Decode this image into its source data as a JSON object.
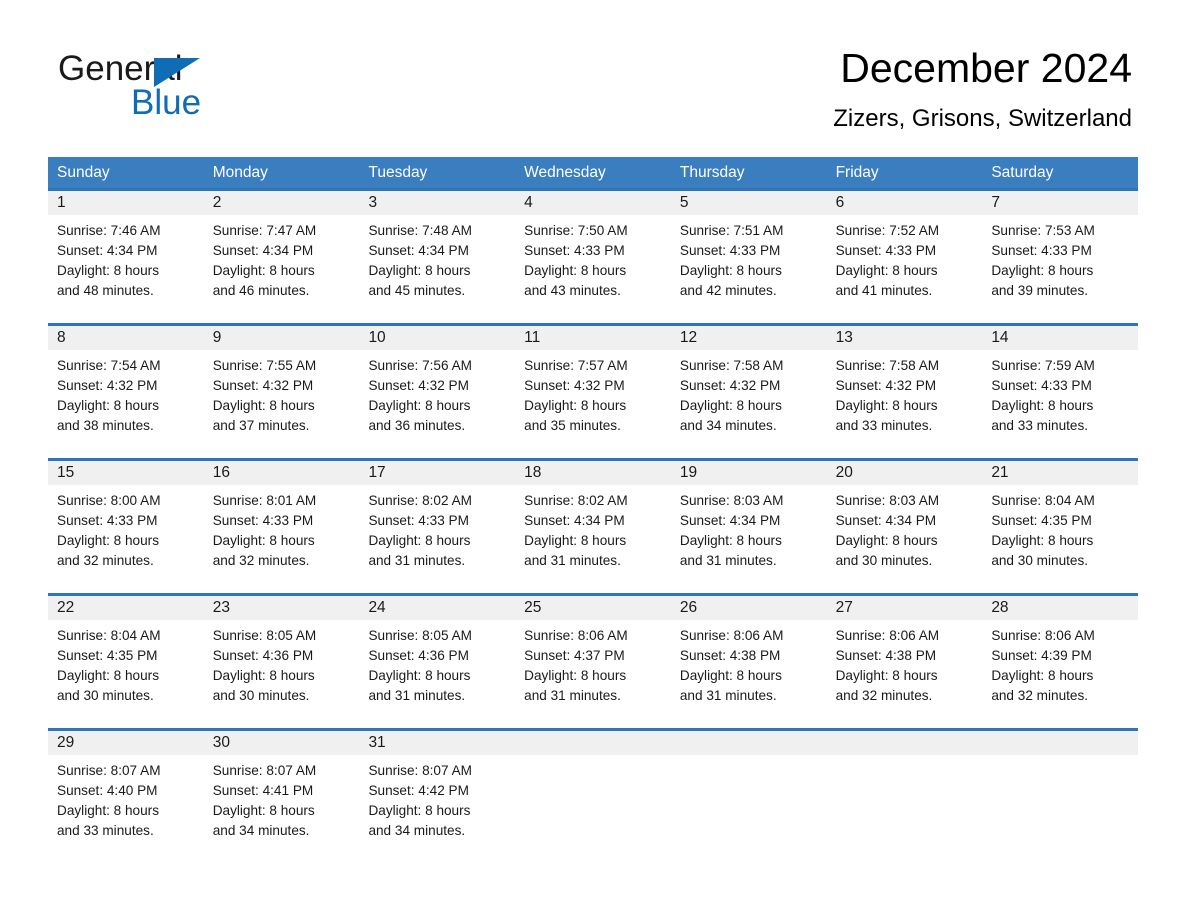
{
  "brand": {
    "name_part1": "General",
    "name_part2": "Blue",
    "triangle_color": "#0f6cb5"
  },
  "header": {
    "title": "December 2024",
    "subtitle": "Zizers, Grisons, Switzerland"
  },
  "theme": {
    "header_blue": "#3a7ebf",
    "rule_blue": "#2f76b8",
    "daynum_band": "#f0f0f0",
    "text": "#1a1a1a",
    "page_background": "#ffffff"
  },
  "calendar": {
    "day_headers": [
      "Sunday",
      "Monday",
      "Tuesday",
      "Wednesday",
      "Thursday",
      "Friday",
      "Saturday"
    ],
    "weeks": [
      [
        {
          "day": "1",
          "sunrise": "Sunrise: 7:46 AM",
          "sunset": "Sunset: 4:34 PM",
          "daylight1": "Daylight: 8 hours",
          "daylight2": "and 48 minutes."
        },
        {
          "day": "2",
          "sunrise": "Sunrise: 7:47 AM",
          "sunset": "Sunset: 4:34 PM",
          "daylight1": "Daylight: 8 hours",
          "daylight2": "and 46 minutes."
        },
        {
          "day": "3",
          "sunrise": "Sunrise: 7:48 AM",
          "sunset": "Sunset: 4:34 PM",
          "daylight1": "Daylight: 8 hours",
          "daylight2": "and 45 minutes."
        },
        {
          "day": "4",
          "sunrise": "Sunrise: 7:50 AM",
          "sunset": "Sunset: 4:33 PM",
          "daylight1": "Daylight: 8 hours",
          "daylight2": "and 43 minutes."
        },
        {
          "day": "5",
          "sunrise": "Sunrise: 7:51 AM",
          "sunset": "Sunset: 4:33 PM",
          "daylight1": "Daylight: 8 hours",
          "daylight2": "and 42 minutes."
        },
        {
          "day": "6",
          "sunrise": "Sunrise: 7:52 AM",
          "sunset": "Sunset: 4:33 PM",
          "daylight1": "Daylight: 8 hours",
          "daylight2": "and 41 minutes."
        },
        {
          "day": "7",
          "sunrise": "Sunrise: 7:53 AM",
          "sunset": "Sunset: 4:33 PM",
          "daylight1": "Daylight: 8 hours",
          "daylight2": "and 39 minutes."
        }
      ],
      [
        {
          "day": "8",
          "sunrise": "Sunrise: 7:54 AM",
          "sunset": "Sunset: 4:32 PM",
          "daylight1": "Daylight: 8 hours",
          "daylight2": "and 38 minutes."
        },
        {
          "day": "9",
          "sunrise": "Sunrise: 7:55 AM",
          "sunset": "Sunset: 4:32 PM",
          "daylight1": "Daylight: 8 hours",
          "daylight2": "and 37 minutes."
        },
        {
          "day": "10",
          "sunrise": "Sunrise: 7:56 AM",
          "sunset": "Sunset: 4:32 PM",
          "daylight1": "Daylight: 8 hours",
          "daylight2": "and 36 minutes."
        },
        {
          "day": "11",
          "sunrise": "Sunrise: 7:57 AM",
          "sunset": "Sunset: 4:32 PM",
          "daylight1": "Daylight: 8 hours",
          "daylight2": "and 35 minutes."
        },
        {
          "day": "12",
          "sunrise": "Sunrise: 7:58 AM",
          "sunset": "Sunset: 4:32 PM",
          "daylight1": "Daylight: 8 hours",
          "daylight2": "and 34 minutes."
        },
        {
          "day": "13",
          "sunrise": "Sunrise: 7:58 AM",
          "sunset": "Sunset: 4:32 PM",
          "daylight1": "Daylight: 8 hours",
          "daylight2": "and 33 minutes."
        },
        {
          "day": "14",
          "sunrise": "Sunrise: 7:59 AM",
          "sunset": "Sunset: 4:33 PM",
          "daylight1": "Daylight: 8 hours",
          "daylight2": "and 33 minutes."
        }
      ],
      [
        {
          "day": "15",
          "sunrise": "Sunrise: 8:00 AM",
          "sunset": "Sunset: 4:33 PM",
          "daylight1": "Daylight: 8 hours",
          "daylight2": "and 32 minutes."
        },
        {
          "day": "16",
          "sunrise": "Sunrise: 8:01 AM",
          "sunset": "Sunset: 4:33 PM",
          "daylight1": "Daylight: 8 hours",
          "daylight2": "and 32 minutes."
        },
        {
          "day": "17",
          "sunrise": "Sunrise: 8:02 AM",
          "sunset": "Sunset: 4:33 PM",
          "daylight1": "Daylight: 8 hours",
          "daylight2": "and 31 minutes."
        },
        {
          "day": "18",
          "sunrise": "Sunrise: 8:02 AM",
          "sunset": "Sunset: 4:34 PM",
          "daylight1": "Daylight: 8 hours",
          "daylight2": "and 31 minutes."
        },
        {
          "day": "19",
          "sunrise": "Sunrise: 8:03 AM",
          "sunset": "Sunset: 4:34 PM",
          "daylight1": "Daylight: 8 hours",
          "daylight2": "and 31 minutes."
        },
        {
          "day": "20",
          "sunrise": "Sunrise: 8:03 AM",
          "sunset": "Sunset: 4:34 PM",
          "daylight1": "Daylight: 8 hours",
          "daylight2": "and 30 minutes."
        },
        {
          "day": "21",
          "sunrise": "Sunrise: 8:04 AM",
          "sunset": "Sunset: 4:35 PM",
          "daylight1": "Daylight: 8 hours",
          "daylight2": "and 30 minutes."
        }
      ],
      [
        {
          "day": "22",
          "sunrise": "Sunrise: 8:04 AM",
          "sunset": "Sunset: 4:35 PM",
          "daylight1": "Daylight: 8 hours",
          "daylight2": "and 30 minutes."
        },
        {
          "day": "23",
          "sunrise": "Sunrise: 8:05 AM",
          "sunset": "Sunset: 4:36 PM",
          "daylight1": "Daylight: 8 hours",
          "daylight2": "and 30 minutes."
        },
        {
          "day": "24",
          "sunrise": "Sunrise: 8:05 AM",
          "sunset": "Sunset: 4:36 PM",
          "daylight1": "Daylight: 8 hours",
          "daylight2": "and 31 minutes."
        },
        {
          "day": "25",
          "sunrise": "Sunrise: 8:06 AM",
          "sunset": "Sunset: 4:37 PM",
          "daylight1": "Daylight: 8 hours",
          "daylight2": "and 31 minutes."
        },
        {
          "day": "26",
          "sunrise": "Sunrise: 8:06 AM",
          "sunset": "Sunset: 4:38 PM",
          "daylight1": "Daylight: 8 hours",
          "daylight2": "and 31 minutes."
        },
        {
          "day": "27",
          "sunrise": "Sunrise: 8:06 AM",
          "sunset": "Sunset: 4:38 PM",
          "daylight1": "Daylight: 8 hours",
          "daylight2": "and 32 minutes."
        },
        {
          "day": "28",
          "sunrise": "Sunrise: 8:06 AM",
          "sunset": "Sunset: 4:39 PM",
          "daylight1": "Daylight: 8 hours",
          "daylight2": "and 32 minutes."
        }
      ],
      [
        {
          "day": "29",
          "sunrise": "Sunrise: 8:07 AM",
          "sunset": "Sunset: 4:40 PM",
          "daylight1": "Daylight: 8 hours",
          "daylight2": "and 33 minutes."
        },
        {
          "day": "30",
          "sunrise": "Sunrise: 8:07 AM",
          "sunset": "Sunset: 4:41 PM",
          "daylight1": "Daylight: 8 hours",
          "daylight2": "and 34 minutes."
        },
        {
          "day": "31",
          "sunrise": "Sunrise: 8:07 AM",
          "sunset": "Sunset: 4:42 PM",
          "daylight1": "Daylight: 8 hours",
          "daylight2": "and 34 minutes."
        },
        {
          "day": "",
          "sunrise": "",
          "sunset": "",
          "daylight1": "",
          "daylight2": ""
        },
        {
          "day": "",
          "sunrise": "",
          "sunset": "",
          "daylight1": "",
          "daylight2": ""
        },
        {
          "day": "",
          "sunrise": "",
          "sunset": "",
          "daylight1": "",
          "daylight2": ""
        },
        {
          "day": "",
          "sunrise": "",
          "sunset": "",
          "daylight1": "",
          "daylight2": ""
        }
      ]
    ]
  }
}
